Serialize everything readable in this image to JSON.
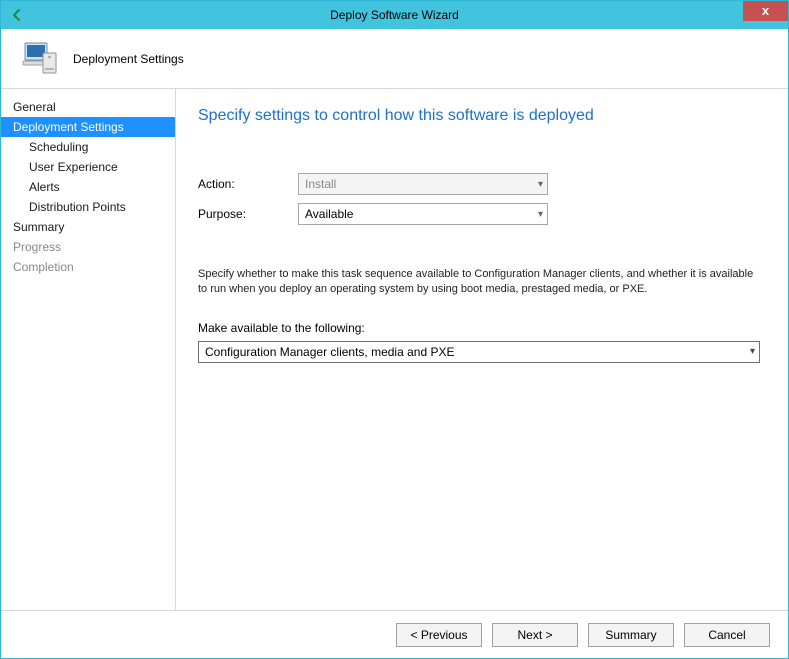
{
  "window": {
    "title": "Deploy Software Wizard",
    "close_label": "x"
  },
  "header": {
    "page_title": "Deployment Settings"
  },
  "sidebar": {
    "items": [
      {
        "label": "General",
        "sub": false,
        "disabled": false
      },
      {
        "label": "Deployment Settings",
        "sub": false,
        "selected": true
      },
      {
        "label": "Scheduling",
        "sub": true
      },
      {
        "label": "User Experience",
        "sub": true
      },
      {
        "label": "Alerts",
        "sub": true
      },
      {
        "label": "Distribution Points",
        "sub": true
      },
      {
        "label": "Summary",
        "sub": false
      },
      {
        "label": "Progress",
        "sub": false,
        "disabled": true
      },
      {
        "label": "Completion",
        "sub": false,
        "disabled": true
      }
    ]
  },
  "content": {
    "heading": "Specify settings to control how this software is deployed",
    "action_label": "Action:",
    "action_value": "Install",
    "purpose_label": "Purpose:",
    "purpose_value": "Available",
    "description": "Specify whether to make this task sequence available to Configuration Manager clients, and whether it is available to run when you deploy an operating system by using boot media, prestaged media, or PXE.",
    "available_label": "Make available to the following:",
    "available_value": "Configuration Manager clients, media and PXE"
  },
  "footer": {
    "previous": "< Previous",
    "next": "Next >",
    "summary": "Summary",
    "cancel": "Cancel"
  }
}
